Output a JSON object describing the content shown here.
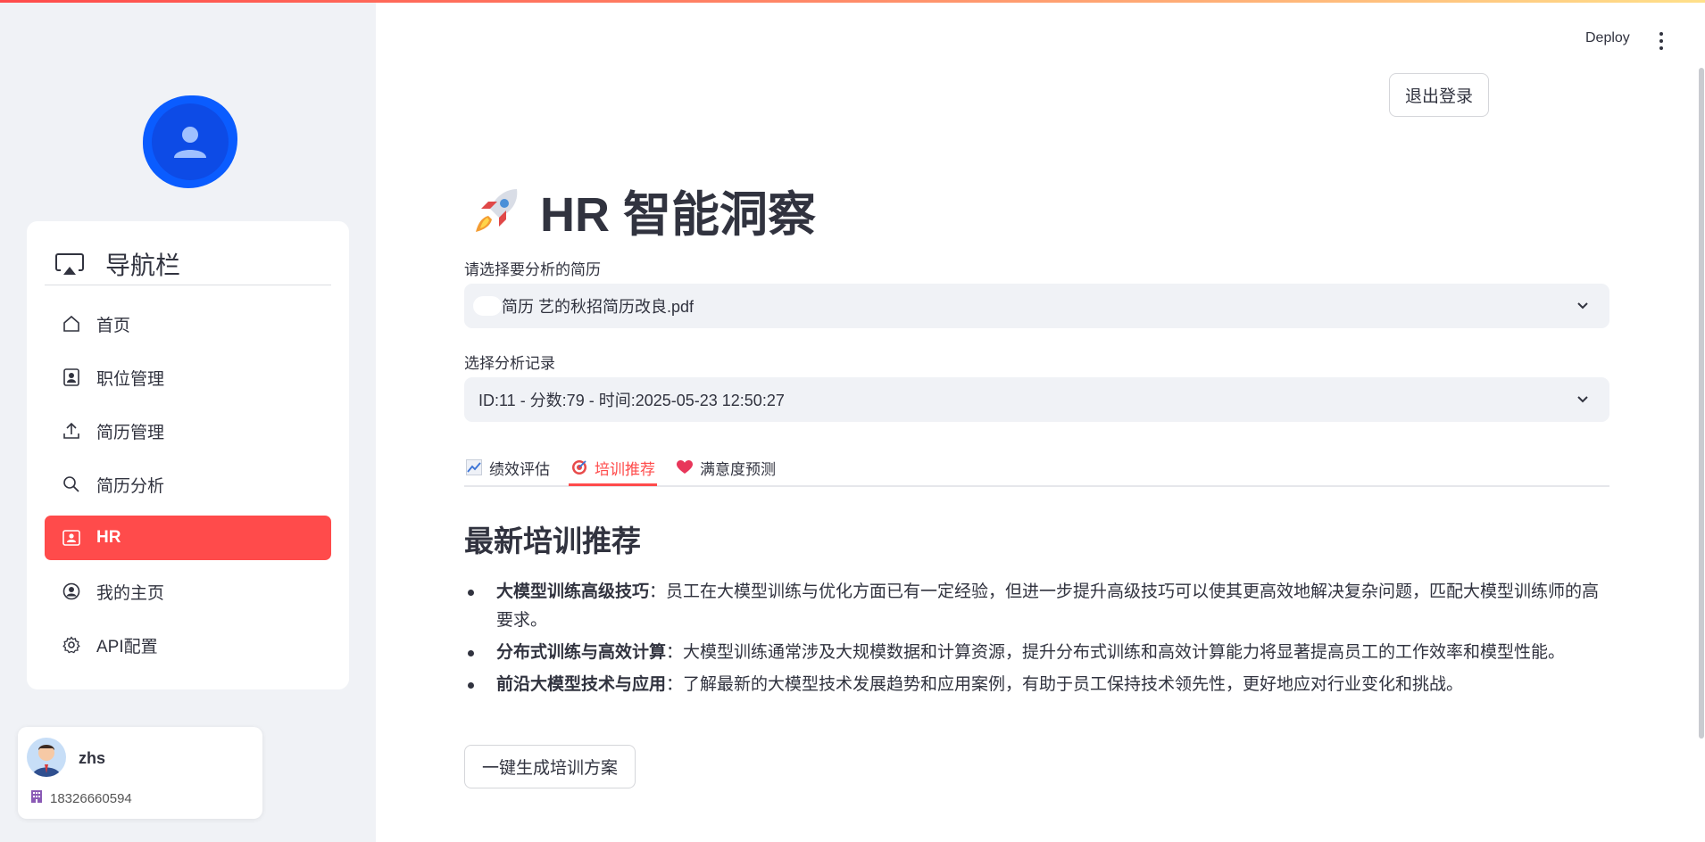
{
  "app": {
    "deploy_label": "Deploy",
    "accent": "#ff4b4b"
  },
  "sidebar": {
    "nav_title": "导航栏",
    "items": [
      {
        "label": "首页",
        "icon": "home-icon"
      },
      {
        "label": "职位管理",
        "icon": "badge-icon"
      },
      {
        "label": "简历管理",
        "icon": "upload-icon"
      },
      {
        "label": "简历分析",
        "icon": "search-icon"
      },
      {
        "label": "HR",
        "icon": "id-card-icon",
        "active": true
      },
      {
        "label": "我的主页",
        "icon": "person-circle-icon"
      },
      {
        "label": "API配置",
        "icon": "gear-icon"
      }
    ],
    "user": {
      "name": "zhs",
      "phone": "18326660594"
    }
  },
  "main": {
    "logout_label": "退出登录",
    "title": "HR 智能洞察",
    "resume_select": {
      "label": "请选择要分析的简历",
      "value": "简历 艺的秋招简历改良.pdf"
    },
    "record_select": {
      "label": "选择分析记录",
      "value": "ID:11 - 分数:79 - 时间:2025-05-23 12:50:27"
    },
    "tabs": [
      {
        "label": "绩效评估",
        "icon": "chart-up-icon"
      },
      {
        "label": "培训推荐",
        "icon": "target-icon",
        "active": true
      },
      {
        "label": "满意度预测",
        "icon": "heart-icon"
      }
    ],
    "section_title": "最新培训推荐",
    "recommendations": [
      {
        "title": "大模型训练高级技巧",
        "text": "：员工在大模型训练与优化方面已有一定经验，但进一步提升高级技巧可以使其更高效地解决复杂问题，匹配大模型训练师的高要求。"
      },
      {
        "title": "分布式训练与高效计算",
        "text": "：大模型训练通常涉及大规模数据和计算资源，提升分布式训练和高效计算能力将显著提高员工的工作效率和模型性能。"
      },
      {
        "title": "前沿大模型技术与应用",
        "text": "：了解最新的大模型技术发展趋势和应用案例，有助于员工保持技术领先性，更好地应对行业变化和挑战。"
      }
    ],
    "generate_label": "一键生成培训方案"
  }
}
